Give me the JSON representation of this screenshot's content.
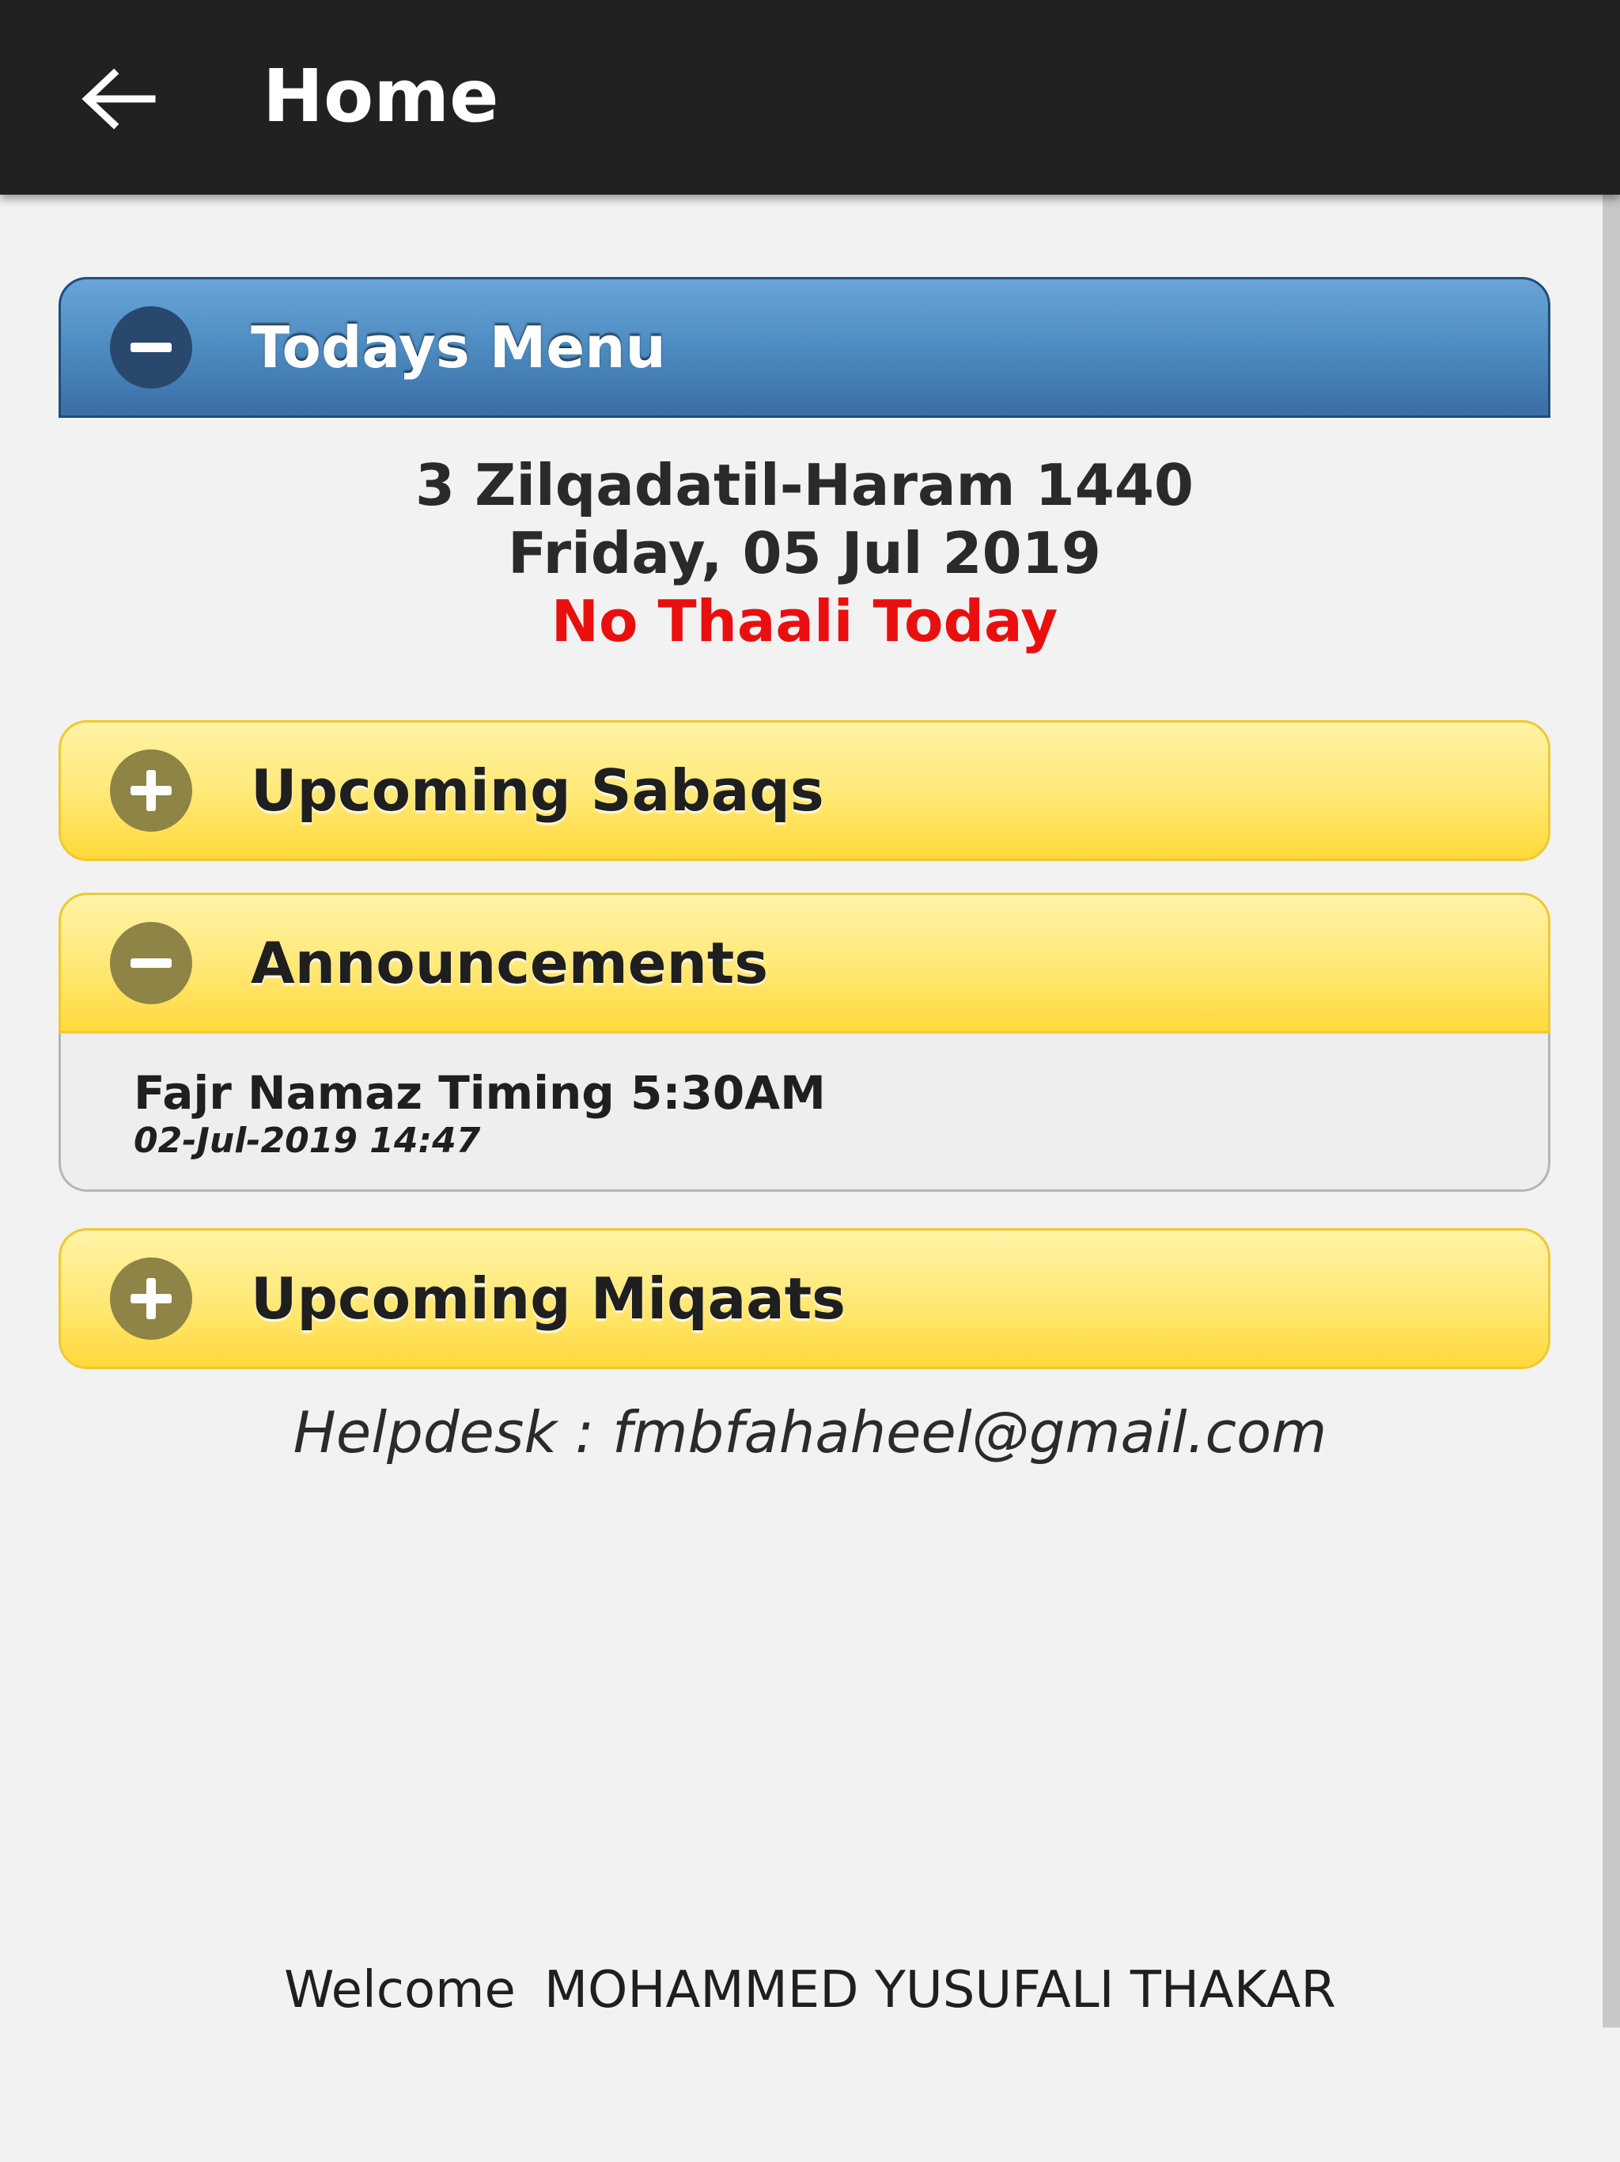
{
  "appbar": {
    "back_icon": "arrow-left-icon",
    "title": "Home"
  },
  "todays_menu": {
    "title": "Todays Menu",
    "toggle_icon": "minus-circle-icon",
    "hijri_date": "3 Zilqadatil-Haram 1440",
    "gregorian_date": "Friday, 05 Jul 2019",
    "status": "No Thaali Today",
    "status_color": "#ea0f0f"
  },
  "upcoming_sabaqs": {
    "title": "Upcoming Sabaqs",
    "toggle_icon": "plus-circle-icon"
  },
  "announcements": {
    "title": "Announcements",
    "toggle_icon": "minus-circle-icon",
    "items": [
      {
        "title": "Fajr Namaz Timing 5:30AM",
        "datetime": "02-Jul-2019 14:47"
      }
    ]
  },
  "upcoming_miqaats": {
    "title": "Upcoming Miqaats",
    "toggle_icon": "plus-circle-icon"
  },
  "helpdesk": {
    "text": "Helpdesk : fmbfahaheel@gmail.com"
  },
  "welcome": {
    "label": "Welcome",
    "user_name": "MOHAMMED YUSUFALI THAKAR"
  },
  "colors": {
    "appbar": "#212121",
    "blue_header": "#4f8ec4",
    "yellow_header": "#ffe979"
  }
}
